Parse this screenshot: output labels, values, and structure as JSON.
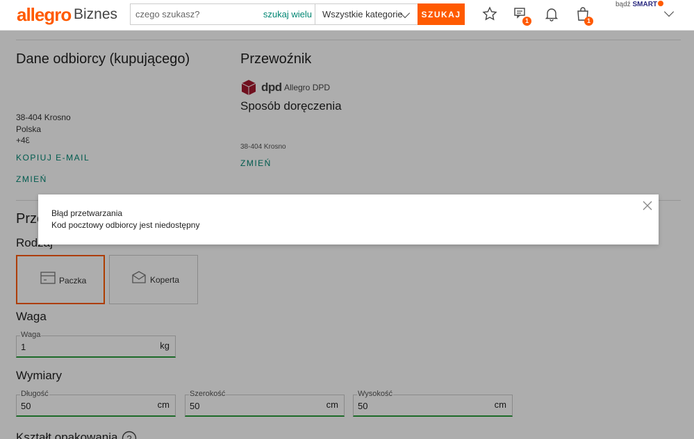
{
  "header": {
    "logo_brand": "allegro",
    "logo_suffix": "Biznes",
    "search_placeholder": "czego szukasz?",
    "search_many": "szukaj wielu",
    "category": "Wszystkie kategorie",
    "search_button": "SZUKAJ",
    "messages_badge": "1",
    "cart_badge": "1",
    "smart_prefix": "bądź",
    "smart_brand": "SMART"
  },
  "recipient": {
    "title": "Dane odbiorcy (kupującego)",
    "postal_city": "38-404 Krosno",
    "country": "Polska",
    "phone_prefix": "+48",
    "copy_email": "KOPIUJ E-MAIL",
    "change": "ZMIEŃ"
  },
  "carrier": {
    "title": "Przewoźnik",
    "logo_text": "dpd",
    "name": "Allegro DPD",
    "delivery_title": "Sposób doręczenia",
    "delivery_city": "38-404 Krosno",
    "change": "ZMIEŃ"
  },
  "package": {
    "section_title_partial": "Prze",
    "type_title": "Rodzaj",
    "types": [
      {
        "label": "Paczka",
        "selected": true
      },
      {
        "label": "Koperta",
        "selected": false
      }
    ],
    "weight_title": "Waga",
    "weight": {
      "label": "Waga",
      "value": "1",
      "unit": "kg"
    },
    "dimensions_title": "Wymiary",
    "dimensions": [
      {
        "label": "Długość",
        "value": "50",
        "unit": "cm"
      },
      {
        "label": "Szerokość",
        "value": "50",
        "unit": "cm"
      },
      {
        "label": "Wysokość",
        "value": "50",
        "unit": "cm"
      }
    ],
    "shape_title": "Kształt opakowania"
  },
  "dialog": {
    "title": "Błąd przetwarzania",
    "message": "Kod pocztowy odbiorcy jest niedostępny"
  },
  "colors": {
    "accent": "#ff5a00",
    "link": "#008673",
    "valid": "#2a9d3c"
  }
}
